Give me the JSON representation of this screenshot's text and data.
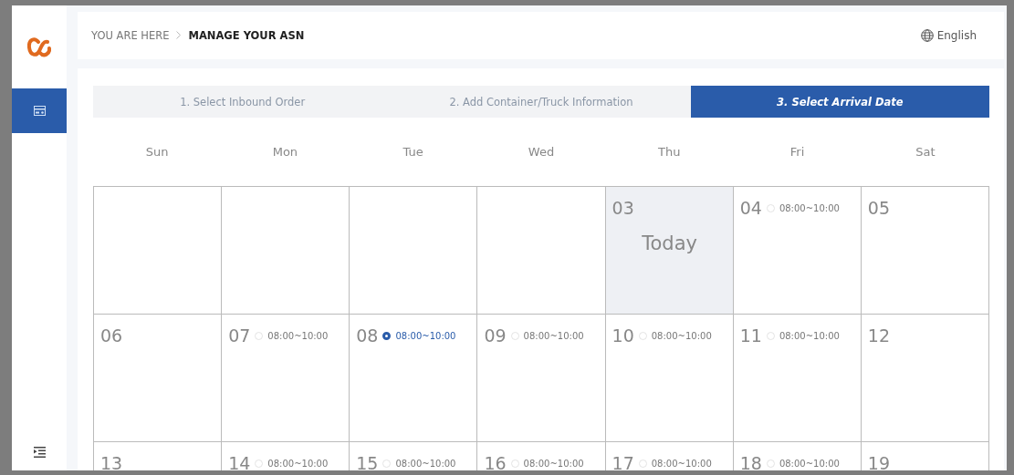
{
  "breadcrumb": {
    "label": "YOU ARE HERE",
    "current": "MANAGE YOUR ASN"
  },
  "language": "English",
  "steps": [
    {
      "label": "1. Select Inbound Order",
      "selected": false
    },
    {
      "label": "2. Add Container/Truck Information",
      "selected": false
    },
    {
      "label": "3. Select Arrival Date",
      "selected": true
    }
  ],
  "weekdays": [
    "Sun",
    "Mon",
    "Tue",
    "Wed",
    "Thu",
    "Fri",
    "Sat"
  ],
  "weeks": [
    [
      {
        "kind": "empty"
      },
      {
        "kind": "empty"
      },
      {
        "kind": "empty"
      },
      {
        "kind": "empty"
      },
      {
        "kind": "today",
        "day": "03",
        "note": "Today"
      },
      {
        "kind": "slot",
        "day": "04",
        "time": "08:00~10:00",
        "selected": false
      },
      {
        "kind": "plain",
        "day": "05"
      }
    ],
    [
      {
        "kind": "plain",
        "day": "06"
      },
      {
        "kind": "slot",
        "day": "07",
        "time": "08:00~10:00",
        "selected": false
      },
      {
        "kind": "slot",
        "day": "08",
        "time": "08:00~10:00",
        "selected": true
      },
      {
        "kind": "slot",
        "day": "09",
        "time": "08:00~10:00",
        "selected": false
      },
      {
        "kind": "slot",
        "day": "10",
        "time": "08:00~10:00",
        "selected": false
      },
      {
        "kind": "slot",
        "day": "11",
        "time": "08:00~10:00",
        "selected": false
      },
      {
        "kind": "plain",
        "day": "12"
      }
    ],
    [
      {
        "kind": "plain",
        "day": "13"
      },
      {
        "kind": "slot",
        "day": "14",
        "time": "08:00~10:00",
        "selected": false
      },
      {
        "kind": "slot",
        "day": "15",
        "time": "08:00~10:00",
        "selected": false
      },
      {
        "kind": "slot",
        "day": "16",
        "time": "08:00~10:00",
        "selected": false
      },
      {
        "kind": "slot",
        "day": "17",
        "time": "08:00~10:00",
        "selected": false
      },
      {
        "kind": "slot",
        "day": "18",
        "time": "08:00~10:00",
        "selected": false
      },
      {
        "kind": "plain",
        "day": "19"
      }
    ]
  ]
}
